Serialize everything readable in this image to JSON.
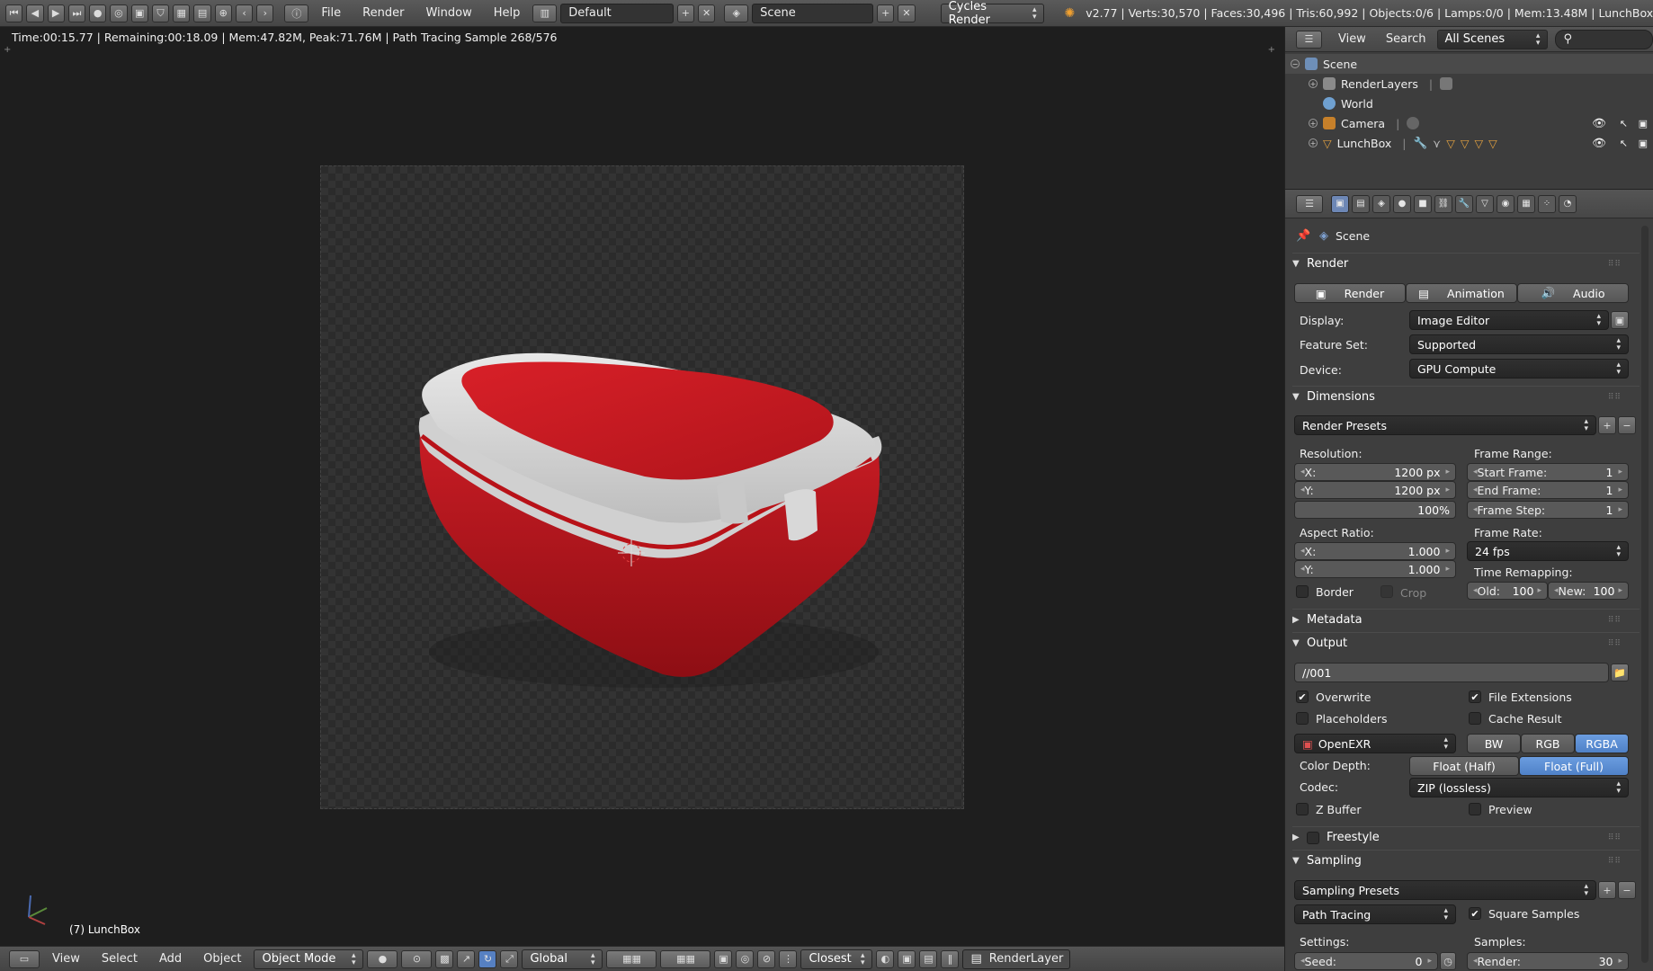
{
  "topbar": {
    "menus": [
      "File",
      "Render",
      "Window",
      "Help"
    ],
    "screen_layout": "Default",
    "scene": "Scene",
    "engine": "Cycles Render",
    "stats": "v2.77 | Verts:30,570 | Faces:30,496 | Tris:60,992 | Objects:0/6 | Lamps:0/0 | Mem:13.48M | LunchBox"
  },
  "viewport": {
    "render_info": "Time:00:15.77 | Remaining:00:18.09 | Mem:47.82M, Peak:71.76M | Path Tracing Sample 268/576",
    "object_label": "(7) LunchBox"
  },
  "bottombar": {
    "menus": [
      "View",
      "Select",
      "Add",
      "Object"
    ],
    "mode": "Object Mode",
    "orientation": "Global",
    "snap": "Closest",
    "render_layer": "RenderLayer"
  },
  "outliner": {
    "menus": [
      "View",
      "Search"
    ],
    "display": "All Scenes",
    "items": [
      {
        "label": "Scene"
      },
      {
        "label": "RenderLayers"
      },
      {
        "label": "World"
      },
      {
        "label": "Camera"
      },
      {
        "label": "LunchBox"
      }
    ]
  },
  "properties": {
    "context": "Scene",
    "render": {
      "title": "Render",
      "buttons": [
        "Render",
        "Animation",
        "Audio"
      ],
      "display_label": "Display:",
      "display_value": "Image Editor",
      "feature_label": "Feature Set:",
      "feature_value": "Supported",
      "device_label": "Device:",
      "device_value": "GPU Compute"
    },
    "dimensions": {
      "title": "Dimensions",
      "presets": "Render Presets",
      "resolution_label": "Resolution:",
      "res_x_k": "X:",
      "res_x": "1200 px",
      "res_y_k": "Y:",
      "res_y": "1200 px",
      "res_pct": "100%",
      "frame_range_label": "Frame Range:",
      "start_k": "Start Frame:",
      "start": "1",
      "end_k": "End Frame:",
      "end": "1",
      "step_k": "Frame Step:",
      "step": "1",
      "aspect_label": "Aspect Ratio:",
      "asp_x_k": "X:",
      "asp_x": "1.000",
      "asp_y_k": "Y:",
      "asp_y": "1.000",
      "frame_rate_label": "Frame Rate:",
      "frame_rate": "24 fps",
      "remap_label": "Time Remapping:",
      "old_k": "Old:",
      "old": "100",
      "new_k": "New:",
      "new": "100",
      "border": "Border",
      "crop": "Crop"
    },
    "metadata": {
      "title": "Metadata"
    },
    "output": {
      "title": "Output",
      "path": "//001",
      "overwrite": "Overwrite",
      "file_ext": "File Extensions",
      "placeholders": "Placeholders",
      "cache": "Cache Result",
      "format": "OpenEXR",
      "bw": "BW",
      "rgb": "RGB",
      "rgba": "RGBA",
      "depth_label": "Color Depth:",
      "float_half": "Float (Half)",
      "float_full": "Float (Full)",
      "codec_label": "Codec:",
      "codec": "ZIP (lossless)",
      "zbuffer": "Z Buffer",
      "preview": "Preview"
    },
    "freestyle": {
      "title": "Freestyle"
    },
    "sampling": {
      "title": "Sampling",
      "presets": "Sampling Presets",
      "integrator": "Path Tracing",
      "square": "Square Samples",
      "settings_label": "Settings:",
      "samples_label": "Samples:",
      "seed_k": "Seed:",
      "seed": "0",
      "render_k": "Render:",
      "render": "30"
    }
  },
  "colors": {
    "accent": "#5680c2",
    "lunchbox_red": "#c0141c",
    "lid_white": "#dcdcdc"
  }
}
